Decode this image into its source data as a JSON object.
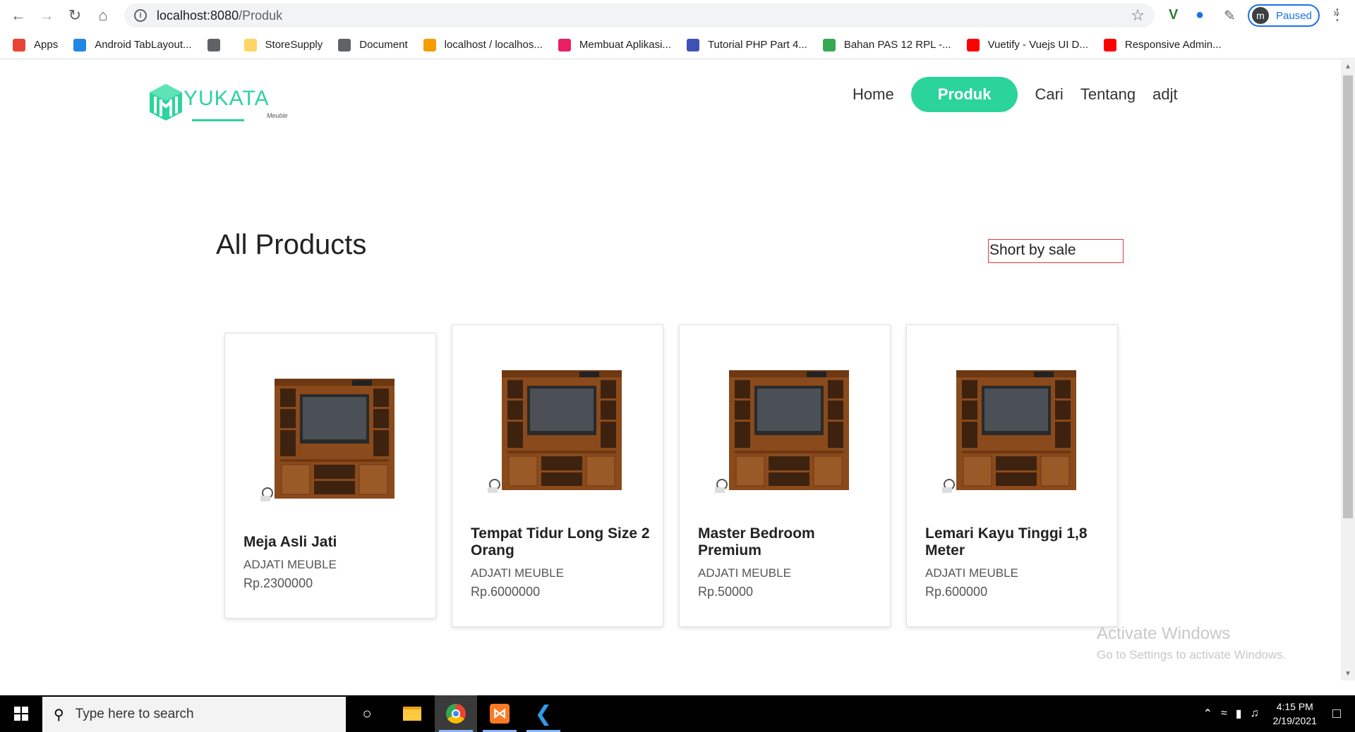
{
  "browser": {
    "url_host": "localhost:8080",
    "url_path": "/Produk",
    "profile_initial": "m",
    "profile_status": "Paused"
  },
  "bookmarks": [
    {
      "label": "Apps",
      "icon": "apps-grid-icon",
      "color": "#ea4335"
    },
    {
      "label": "Android TabLayout...",
      "icon": "android-icon",
      "color": "#1e88e5"
    },
    {
      "label": "",
      "icon": "globe-icon",
      "color": "#5f6368"
    },
    {
      "label": "StoreSupply",
      "icon": "folder-icon",
      "color": "#fdd663"
    },
    {
      "label": "Document",
      "icon": "globe-icon",
      "color": "#5f6368"
    },
    {
      "label": "localhost / localhos...",
      "icon": "phpmyadmin-icon",
      "color": "#f59d00"
    },
    {
      "label": "Membuat Aplikasi...",
      "icon": "site-icon",
      "color": "#e91e63"
    },
    {
      "label": "Tutorial PHP Part 4...",
      "icon": "w3-icon",
      "color": "#3f51b5"
    },
    {
      "label": "Bahan PAS 12 RPL -...",
      "icon": "drive-icon",
      "color": "#34a853"
    },
    {
      "label": "Vuetify - Vuejs UI D...",
      "icon": "youtube-icon",
      "color": "#ff0000"
    },
    {
      "label": "Responsive Admin...",
      "icon": "youtube-icon",
      "color": "#ff0000"
    }
  ],
  "site": {
    "logo_text": "YUKATA",
    "logo_sub": "Meuble",
    "nav": [
      "Home",
      "Produk",
      "Cari",
      "Tentang",
      "adjt"
    ],
    "active_nav": "Produk",
    "accent_color": "#2bd49a"
  },
  "main": {
    "title": "All Products",
    "sort_label": "Short by sale"
  },
  "products": [
    {
      "name": "Meja Asli Jati",
      "brand": "ADJATI MEUBLE",
      "price": "Rp.2300000"
    },
    {
      "name": "Tempat Tidur Long Size 2 Orang",
      "brand": "ADJATI MEUBLE",
      "price": "Rp.6000000"
    },
    {
      "name": "Master Bedroom Premium",
      "brand": "ADJATI MEUBLE",
      "price": "Rp.50000"
    },
    {
      "name": "Lemari Kayu Tinggi 1,8 Meter",
      "brand": "ADJATI MEUBLE",
      "price": "Rp.600000"
    }
  ],
  "watermark": {
    "line1": "Activate Windows",
    "line2": "Go to Settings to activate Windows."
  },
  "taskbar": {
    "search_placeholder": "Type here to search",
    "time": "4:15 PM",
    "date": "2/19/2021"
  }
}
